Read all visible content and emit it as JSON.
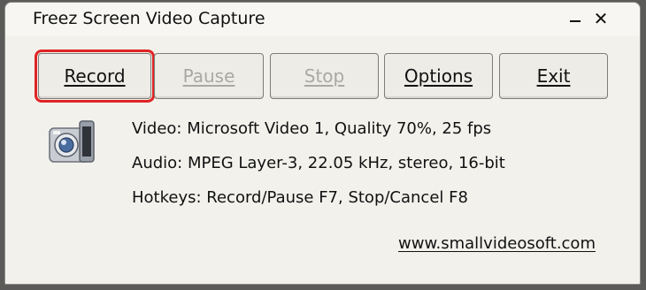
{
  "window": {
    "title": "Freez Screen Video Capture",
    "minimize_glyph": "_",
    "close_glyph": "✕"
  },
  "toolbar": {
    "record_label": "Record",
    "pause_label": "Pause",
    "stop_label": "Stop",
    "options_label": "Options",
    "exit_label": "Exit"
  },
  "info": {
    "video": "Video: Microsoft Video 1, Quality 70%, 25 fps",
    "audio": "Audio: MPEG Layer-3, 22.05 kHz, stereo, 16-bit",
    "hotkeys": "Hotkeys: Record/Pause F7, Stop/Cancel F8"
  },
  "website_link": "www.smallvideosoft.com",
  "icons": {
    "app": "camera-icon",
    "minimize": "minimize-icon",
    "close": "close-icon"
  },
  "colors": {
    "highlight": "#e02424",
    "window_bg": "#f2f1ec",
    "disabled_text": "#a9a9a4"
  }
}
